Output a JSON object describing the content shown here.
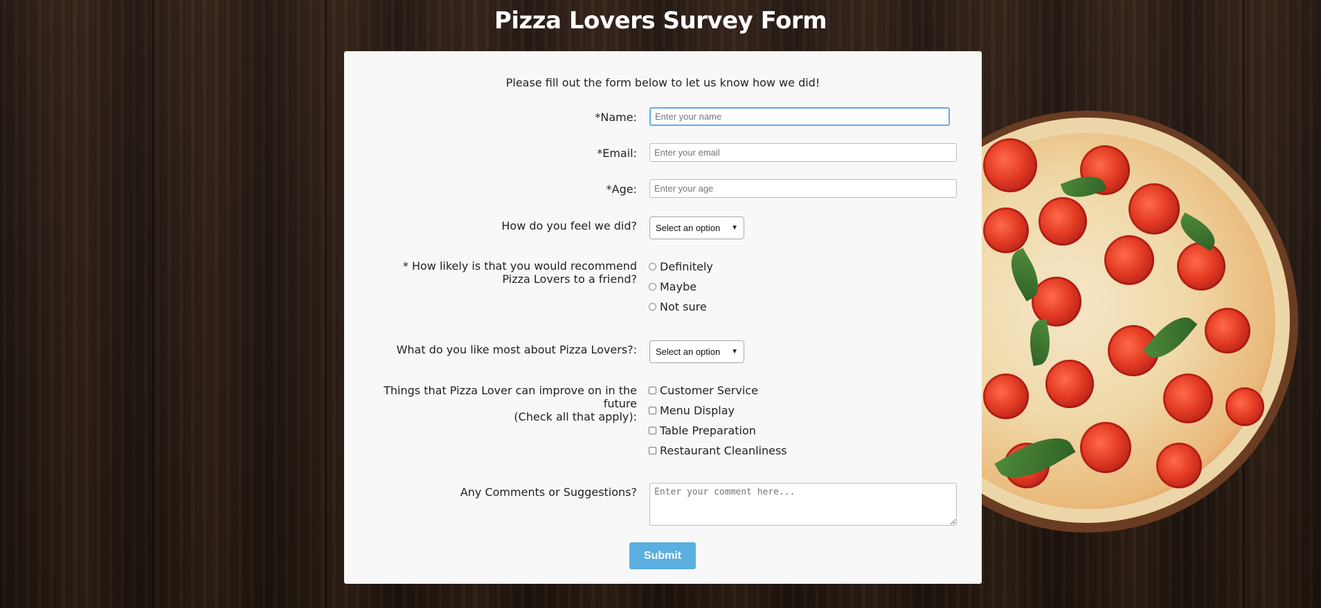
{
  "page": {
    "title": "Pizza Lovers Survey Form",
    "intro": "Please fill out the form below to let us know how we did!"
  },
  "form": {
    "name": {
      "label": "*Name:",
      "placeholder": "Enter your name",
      "value": ""
    },
    "email": {
      "label": "*Email:",
      "placeholder": "Enter your email",
      "value": ""
    },
    "age": {
      "label": "*Age:",
      "placeholder": "Enter your age",
      "value": ""
    },
    "feel": {
      "label": "How do you feel we did?",
      "selected": "Select an option"
    },
    "recommend": {
      "label_line1": "* How likely is that you would recommend",
      "label_line2": "Pizza Lovers to a friend?",
      "options": [
        "Definitely",
        "Maybe",
        "Not sure"
      ]
    },
    "like_most": {
      "label": "What do you like most about Pizza Lovers?:",
      "selected": "Select an option"
    },
    "improve": {
      "label_line1": "Things that Pizza Lover can improve on in the",
      "label_line2": "future",
      "label_line3": "(Check all that apply):",
      "options": [
        "Customer Service",
        "Menu Display",
        "Table Preparation",
        "Restaurant Cleanliness"
      ]
    },
    "comments": {
      "label": "Any Comments or Suggestions?",
      "placeholder": "Enter your comment here..."
    },
    "submit_label": "Submit"
  },
  "colors": {
    "accent": "#5aaee0",
    "focus": "#6aa7e6",
    "card": "#f8f8f8"
  }
}
